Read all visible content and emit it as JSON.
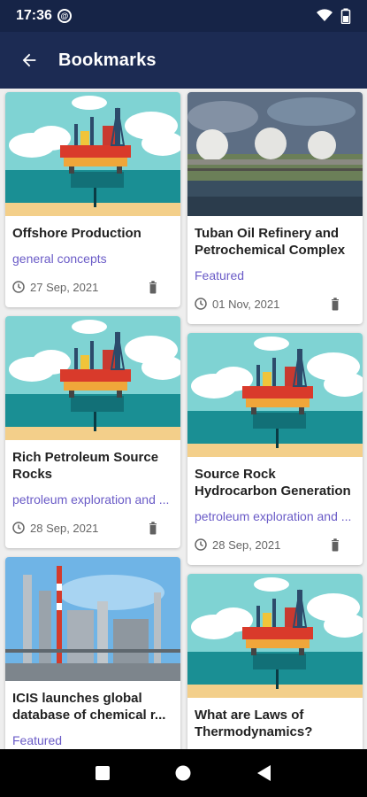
{
  "status_bar": {
    "time": "17:36",
    "badge": "@"
  },
  "app_bar": {
    "title": "Bookmarks"
  },
  "left_column": [
    {
      "title": "Offshore Production",
      "category": "general concepts",
      "date": "27 Sep, 2021",
      "image": "offshore-platform"
    },
    {
      "title": "Rich Petroleum Source Rocks",
      "category": "petroleum exploration and ...",
      "date": "28 Sep, 2021",
      "image": "offshore-platform"
    },
    {
      "title": "ICIS launches global database of chemical r...",
      "category": "Featured",
      "date": "",
      "image": "refinery"
    }
  ],
  "right_column": [
    {
      "title": "Tuban Oil Refinery and Petrochemical Complex",
      "category": "Featured",
      "date": "01 Nov, 2021",
      "image": "storage-spheres"
    },
    {
      "title": "Source Rock Hydrocarbon Generation",
      "category": "petroleum exploration and ...",
      "date": "28 Sep, 2021",
      "image": "offshore-platform"
    },
    {
      "title": "What are Laws of Thermodynamics?",
      "category": "",
      "date": "",
      "image": "offshore-platform"
    }
  ],
  "colors": {
    "status_bar": "#162447",
    "app_bar": "#1c2b53",
    "category_text": "#6a5bc7",
    "background": "#eeeeee"
  },
  "icons": {
    "back": "arrow-left-icon",
    "clock": "clock-icon",
    "delete": "trash-icon"
  }
}
